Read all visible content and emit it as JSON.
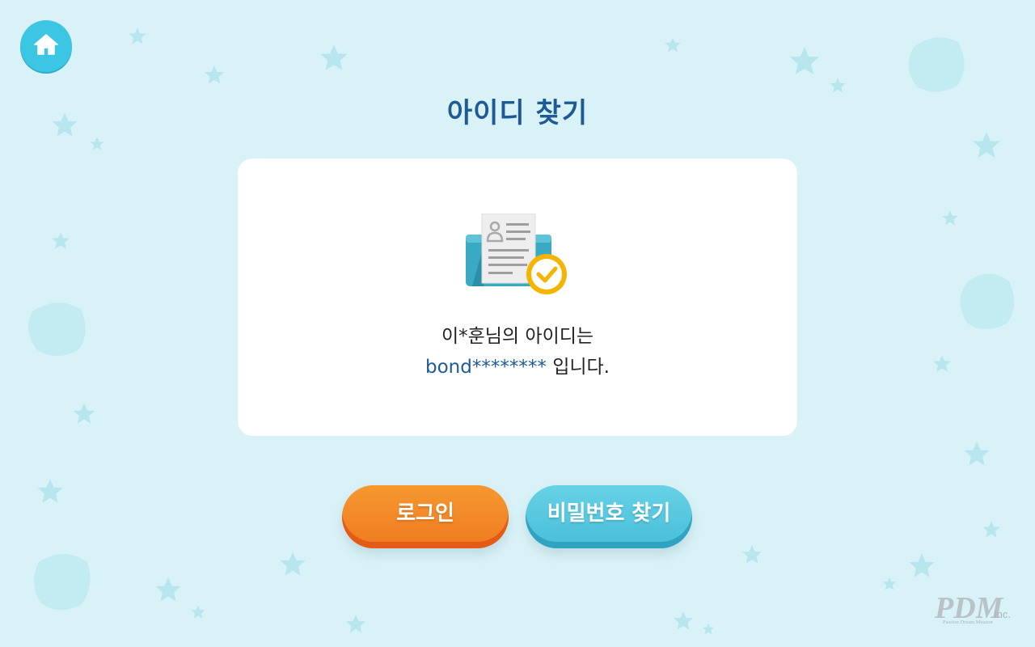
{
  "header": {
    "title": "아이디 찾기"
  },
  "result": {
    "message_line1": "이*훈님의 아이디는",
    "masked_id": "bond********",
    "message_suffix": "입니다."
  },
  "buttons": {
    "login": "로그인",
    "find_password": "비밀번호 찾기"
  },
  "logo": {
    "text": "PDM",
    "suffix": "Inc.",
    "tagline": "Passion Dream Mission"
  },
  "colors": {
    "background": "#d9f2f7",
    "title": "#1d5a98",
    "accent_orange": "#f28a26",
    "accent_cyan": "#4cc4dc",
    "home_button": "#3cc6e3"
  },
  "icons": {
    "home": "home-icon",
    "illustration": "document-check-icon"
  }
}
